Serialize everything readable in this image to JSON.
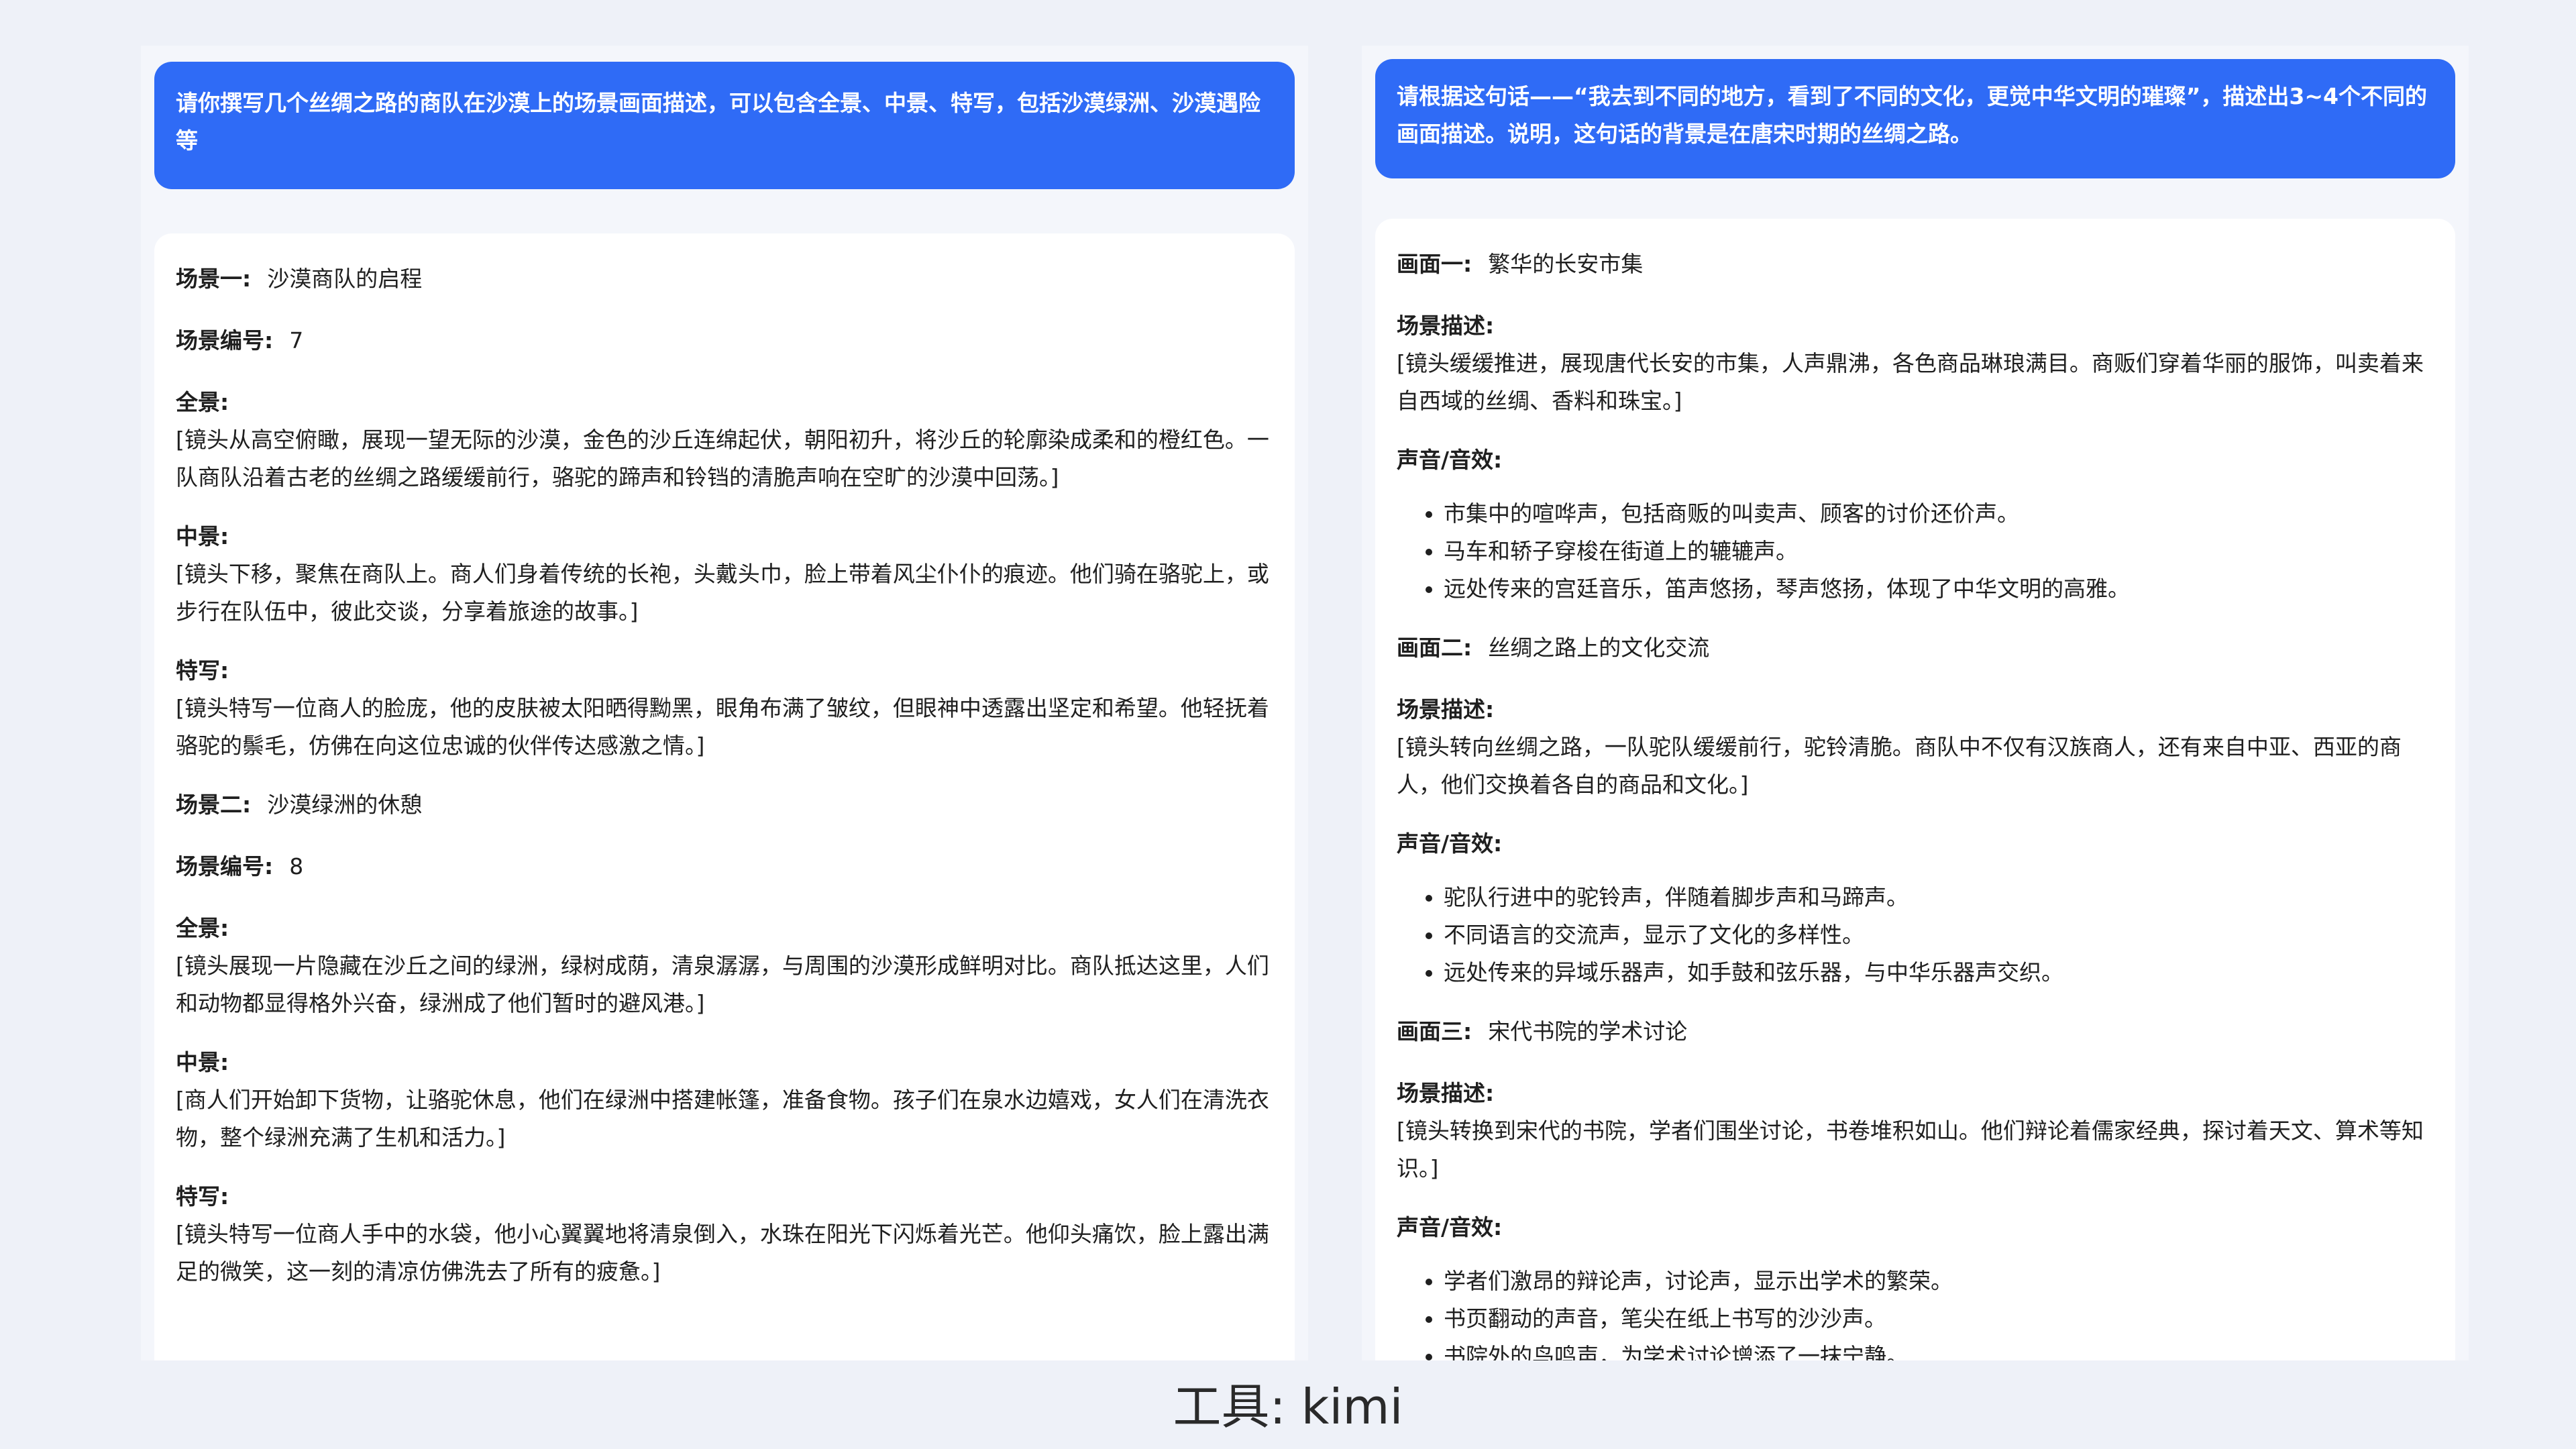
{
  "left": {
    "prompt": "请你撰写几个丝绸之路的商队在沙漠上的场景画面描述，可以包含全景、中景、特写，包括沙漠绿洲、沙漠遇险等",
    "scenes": [
      {
        "title_label": "场景一:",
        "title": "沙漠商队的启程",
        "num_label": "场景编号:",
        "num": "7",
        "full_label": "全景:",
        "full": "[镜头从高空俯瞰，展现一望无际的沙漠，金色的沙丘连绵起伏，朝阳初升，将沙丘的轮廓染成柔和的橙红色。一队商队沿着古老的丝绸之路缓缓前行，骆驼的蹄声和铃铛的清脆声响在空旷的沙漠中回荡。]",
        "mid_label": "中景:",
        "mid": "[镜头下移，聚焦在商队上。商人们身着传统的长袍，头戴头巾，脸上带着风尘仆仆的痕迹。他们骑在骆驼上，或步行在队伍中，彼此交谈，分享着旅途的故事。]",
        "close_label": "特写:",
        "close": "[镜头特写一位商人的脸庞，他的皮肤被太阳晒得黝黑，眼角布满了皱纹，但眼神中透露出坚定和希望。他轻抚着骆驼的鬃毛，仿佛在向这位忠诚的伙伴传达感激之情。]"
      },
      {
        "title_label": "场景二:",
        "title": "沙漠绿洲的休憩",
        "num_label": "场景编号:",
        "num": "8",
        "full_label": "全景:",
        "full": "[镜头展现一片隐藏在沙丘之间的绿洲，绿树成荫，清泉潺潺，与周围的沙漠形成鲜明对比。商队抵达这里，人们和动物都显得格外兴奋，绿洲成了他们暂时的避风港。]",
        "mid_label": "中景:",
        "mid": "[商人们开始卸下货物，让骆驼休息，他们在绿洲中搭建帐篷，准备食物。孩子们在泉水边嬉戏，女人们在清洗衣物，整个绿洲充满了生机和活力。]",
        "close_label": "特写:",
        "close": "[镜头特写一位商人手中的水袋，他小心翼翼地将清泉倒入，水珠在阳光下闪烁着光芒。他仰头痛饮，脸上露出满足的微笑，这一刻的清凉仿佛洗去了所有的疲惫。]"
      }
    ]
  },
  "right": {
    "prompt": "请根据这句话——“我去到不同的地方，看到了不同的文化，更觉中华文明的璀璨”，描述出3~4个不同的画面描述。说明，这句话的背景是在唐宋时期的丝绸之路。",
    "scenes": [
      {
        "title_label": "画面一:",
        "title": "繁华的长安市集",
        "desc_label": "场景描述:",
        "desc": "[镜头缓缓推进，展现唐代长安的市集，人声鼎沸，各色商品琳琅满目。商贩们穿着华丽的服饰，叫卖着来自西域的丝绸、香料和珠宝。]",
        "sound_label": "声音/音效:",
        "sounds": [
          "市集中的喧哗声，包括商贩的叫卖声、顾客的讨价还价声。",
          "马车和轿子穿梭在街道上的辘辘声。",
          "远处传来的宫廷音乐，笛声悠扬，琴声悠扬，体现了中华文明的高雅。"
        ]
      },
      {
        "title_label": "画面二:",
        "title": "丝绸之路上的文化交流",
        "desc_label": "场景描述:",
        "desc": "[镜头转向丝绸之路，一队驼队缓缓前行，驼铃清脆。商队中不仅有汉族商人，还有来自中亚、西亚的商人，他们交换着各自的商品和文化。]",
        "sound_label": "声音/音效:",
        "sounds": [
          "驼队行进中的驼铃声，伴随着脚步声和马蹄声。",
          "不同语言的交流声，显示了文化的多样性。",
          "远处传来的异域乐器声，如手鼓和弦乐器，与中华乐器声交织。"
        ]
      },
      {
        "title_label": "画面三:",
        "title": "宋代书院的学术讨论",
        "desc_label": "场景描述:",
        "desc": "[镜头转换到宋代的书院，学者们围坐讨论，书卷堆积如山。他们辩论着儒家经典，探讨着天文、算术等知识。]",
        "sound_label": "声音/音效:",
        "sounds": [
          "学者们激昂的辩论声，讨论声，显示出学术的繁荣。",
          "书页翻动的声音，笔尖在纸上书写的沙沙声。",
          "书院外的鸟鸣声，为学术讨论增添了一抹宁静。"
        ]
      }
    ]
  },
  "caption": "工具: kimi"
}
